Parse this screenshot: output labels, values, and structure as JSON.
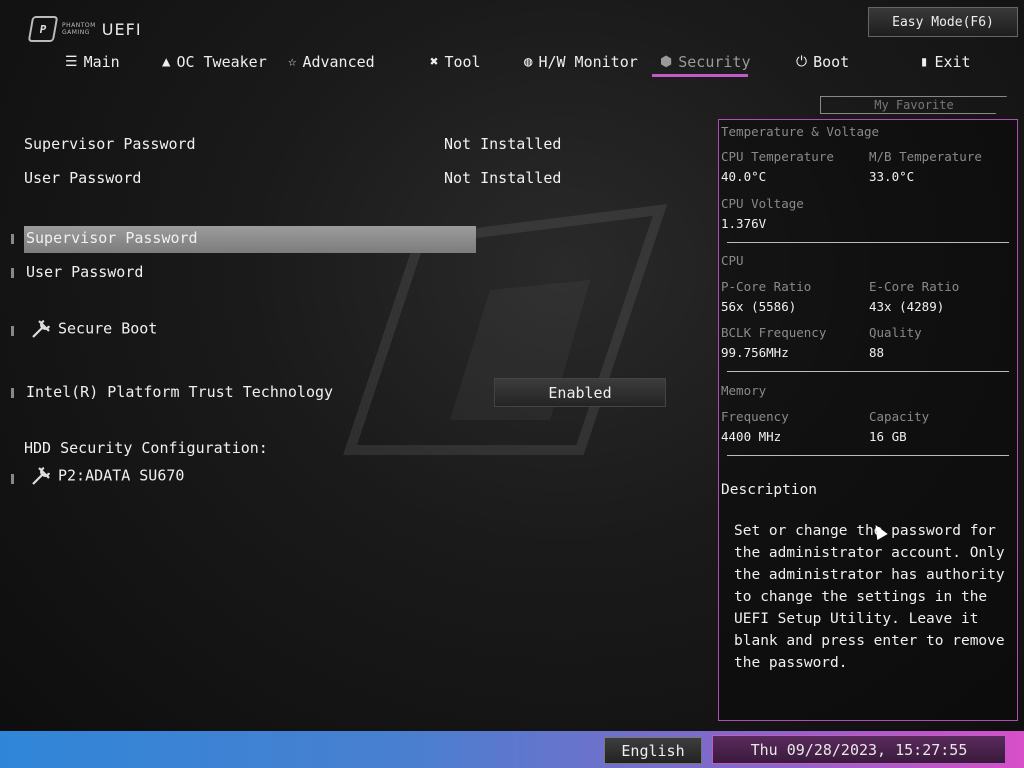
{
  "header": {
    "logo_small_1": "PHANTOM",
    "logo_small_2": "GAMING",
    "logo_main": "UEFI",
    "easy_mode": "Easy Mode(F6)",
    "favorite": "My Favorite"
  },
  "tabs": [
    {
      "label": "Main",
      "icon": "list-icon",
      "glyph": "☰"
    },
    {
      "label": "OC Tweaker",
      "icon": "rocket-icon",
      "glyph": "🜂"
    },
    {
      "label": "Advanced",
      "icon": "star-icon",
      "glyph": "☆"
    },
    {
      "label": "Tool",
      "icon": "tools-icon",
      "glyph": "✖"
    },
    {
      "label": "H/W Monitor",
      "icon": "monitor-icon",
      "glyph": "◍"
    },
    {
      "label": "Security",
      "icon": "shield-icon",
      "glyph": "⬢",
      "active": true
    },
    {
      "label": "Boot",
      "icon": "power-icon",
      "glyph": "⏻"
    },
    {
      "label": "Exit",
      "icon": "exit-icon",
      "glyph": "▮"
    }
  ],
  "main": {
    "supervisor_password_label": "Supervisor Password",
    "supervisor_password_status": "Not Installed",
    "user_password_label": "User Password",
    "user_password_status": "Not Installed",
    "set_supervisor_password": "Supervisor Password",
    "set_user_password": "User Password",
    "secure_boot": "Secure Boot",
    "ptt_label": "Intel(R) Platform Trust Technology",
    "ptt_value": "Enabled",
    "hdd_section": "HDD Security Configuration:",
    "hdd_device": "P2:ADATA SU670"
  },
  "panel": {
    "section_tv": "Temperature & Voltage",
    "cpu_temp_label": "CPU Temperature",
    "cpu_temp": "40.0°C",
    "mb_temp_label": "M/B Temperature",
    "mb_temp": "33.0°C",
    "cpu_voltage_label": "CPU Voltage",
    "cpu_voltage": "1.376V",
    "section_cpu": "CPU",
    "pcore_label": "P-Core Ratio",
    "pcore": "56x (5586)",
    "ecore_label": "E-Core Ratio",
    "ecore": "43x (4289)",
    "bclk_label": "BCLK Frequency",
    "bclk": "99.756MHz",
    "quality_label": "Quality",
    "quality": "88",
    "section_mem": "Memory",
    "freq_label": "Frequency",
    "freq": "4400 MHz",
    "cap_label": "Capacity",
    "cap": "16 GB",
    "desc_title": "Description",
    "desc_lines": [
      "Set or change the password for",
      "the administrator account. Only",
      "the administrator has authority",
      "to change the settings in the",
      "UEFI Setup Utility. Leave it",
      "blank and press enter to remove",
      "the password."
    ]
  },
  "footer": {
    "language": "English",
    "datetime": "Thu 09/28/2023, 15:27:55"
  },
  "colors": {
    "accent": "#c45ac6",
    "footer_start": "#2f86d8",
    "footer_end": "#d84fc8"
  }
}
